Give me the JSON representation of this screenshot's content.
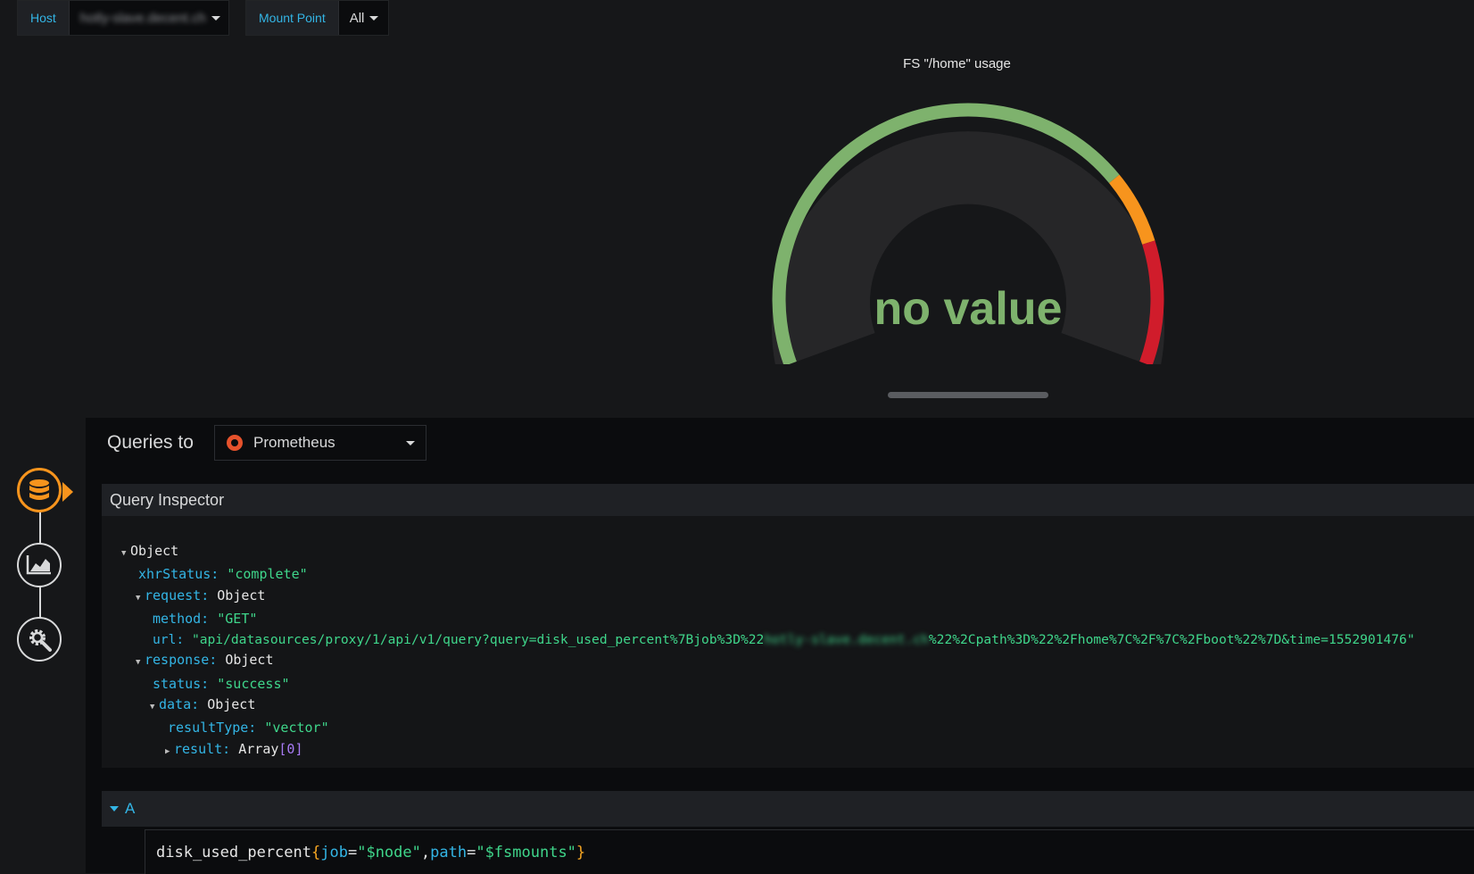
{
  "variables": [
    {
      "label": "Host",
      "value": "hotly-slave.decent.ch"
    },
    {
      "label": "Mount Point",
      "value": "All"
    }
  ],
  "gauge": {
    "title": "FS \"/home\" usage",
    "value_text": "no value",
    "colors": {
      "ok": "#7eb26d",
      "warn": "#f7941d",
      "crit": "#d01c2b",
      "track": "#262628"
    }
  },
  "editor": {
    "queries_to_label": "Queries to",
    "datasource": {
      "name": "Prometheus",
      "icon": "prometheus-icon"
    },
    "side_nav": [
      {
        "name": "queries",
        "icon": "database-icon",
        "active": true
      },
      {
        "name": "visualization",
        "icon": "area-chart-icon",
        "active": false
      },
      {
        "name": "general",
        "icon": "gear-icon",
        "active": false
      }
    ],
    "inspector": {
      "title": "Query Inspector",
      "root": "Object",
      "xhrStatus_key": "xhrStatus:",
      "xhrStatus_val": "\"complete\"",
      "request_key": "request:",
      "request_val": "Object",
      "method_key": "method:",
      "method_val": "\"GET\"",
      "url_key": "url:",
      "url_val_pre": "\"api/datasources/proxy/1/api/v1/query?query=disk_used_percent%7Bjob%3D%22",
      "url_val_host": "hotly-slave.decent.ch",
      "url_val_post": "%22%2Cpath%3D%22%2Fhome%7C%2F%7C%2Fboot%22%7D&time=1552901476\"",
      "response_key": "response:",
      "response_val": "Object",
      "status_key": "status:",
      "status_val": "\"success\"",
      "data_key": "data:",
      "data_val": "Object",
      "resultType_key": "resultType:",
      "resultType_val": "\"vector\"",
      "result_key": "result:",
      "result_val": "Array",
      "result_len": "[0]"
    },
    "query": {
      "ref": "A",
      "metric": "disk_used_percent",
      "open_brace": "{",
      "label1_key": "job",
      "label1_val": "\"$node\"",
      "label2_key": "path",
      "label2_val": "\"$fsmounts\"",
      "close_brace": "}",
      "eq": "=",
      "comma": ","
    }
  }
}
